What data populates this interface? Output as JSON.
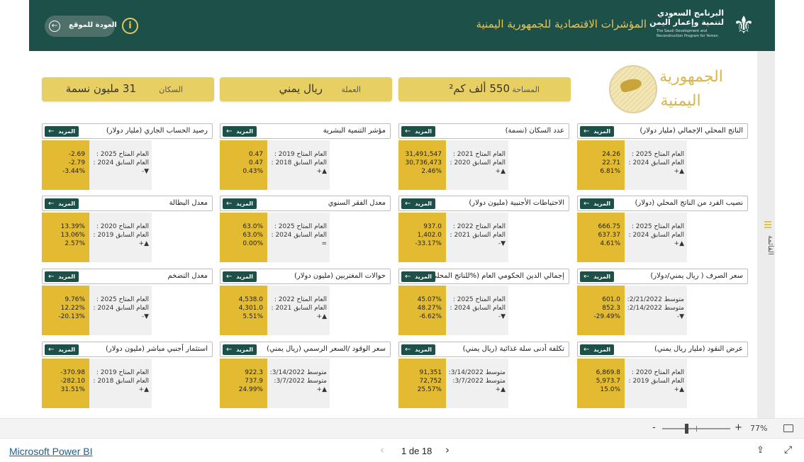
{
  "header": {
    "logo_ar_line1": "البرنامج السعودي",
    "logo_ar_line2": "لتنمية وإعمار اليمن",
    "logo_en": "The Saudi Development and Reconstruction Program for Yemen",
    "title": "المؤشرات الاقتصادية للجمهورية اليمنية",
    "info_glyph": "i",
    "back_label": "العودة للموقع",
    "back_glyph": "←"
  },
  "country": {
    "line1": "الجمهورية",
    "line2": "اليمنية"
  },
  "stats": [
    {
      "label": "المساحة",
      "value": "550 ألف كم²"
    },
    {
      "label": "العملة",
      "value": "ريال يمني"
    },
    {
      "label": "السكان",
      "value": "31 مليون نسمة"
    }
  ],
  "more_label": "المزيد",
  "more_glyph": "←",
  "cards": [
    {
      "title": "الناتج المحلي الإجمالي (مليار دولار)",
      "l1": "العام المتاح 2025 :",
      "l2": "العام السابق 2024 :",
      "trend": "▲+",
      "v1": "24.26",
      "v2": "22.71",
      "v3": "6.81%"
    },
    {
      "title": "عدد السكان (نسمة)",
      "l1": "العام المتاح 2021 :",
      "l2": "العام السابق 2020 :",
      "trend": "▲+",
      "v1": "31,491,547",
      "v2": "30,736,473",
      "v3": "2.46%"
    },
    {
      "title": "مؤشر التنمية البشرية",
      "l1": "العام المتاح 2019 :",
      "l2": "العام السابق 2018 :",
      "trend": "▲+",
      "v1": "0.47",
      "v2": "0.47",
      "v3": "0.43%"
    },
    {
      "title": "رصيد الحساب الجاري (مليار دولار)",
      "l1": "العام المتاح 2025 :",
      "l2": "العام السابق 2024 :",
      "trend": "▼-",
      "v1": "-2.69",
      "v2": "-2.79",
      "v3": "-3.44%"
    },
    {
      "title": "نصيب الفرد من الناتج المحلي (دولار)",
      "l1": "العام المتاح 2025 :",
      "l2": "العام السابق 2024 :",
      "trend": "▲+",
      "v1": "666.75",
      "v2": "637.37",
      "v3": "4.61%"
    },
    {
      "title": "الاحتياطات الأجنبية (مليون دولار)",
      "l1": "العام المتاح 2022 :",
      "l2": "العام السابق 2021 :",
      "trend": "▼-",
      "v1": "937.0",
      "v2": "1,402.0",
      "v3": "-33.17%"
    },
    {
      "title": "معدل الفقر السنوي",
      "l1": "العام المتاح 2025 :",
      "l2": "العام السابق 2024 :",
      "trend": "=",
      "v1": "63.0%",
      "v2": "63.0%",
      "v3": "0.00%"
    },
    {
      "title": "معدل البطالة",
      "l1": "العام المتاح 2020 :",
      "l2": "العام السابق 2019 :",
      "trend": "▲+",
      "v1": "13.39%",
      "v2": "13.06%",
      "v3": "2.57%"
    },
    {
      "title": "سعر الصرف ( ريال يمني/دولار)",
      "l1": "متوسط 2/21/2022:",
      "l2": "متوسط 2/14/2022:",
      "trend": "▼-",
      "v1": "601.0",
      "v2": "852.3",
      "v3": "-29.49%"
    },
    {
      "title": "إجمالي الدين الحكومي العام (%للناتج المحلي)",
      "l1": "العام المتاح 2025 :",
      "l2": "العام السابق 2024 :",
      "trend": "▼-",
      "v1": "45.07%",
      "v2": "48.27%",
      "v3": "-6.62%"
    },
    {
      "title": "حوالات المغتربين (مليون دولار)",
      "l1": "العام المتاح 2022 :",
      "l2": "العام السابق 2021 :",
      "trend": "▲+",
      "v1": "4,538.0",
      "v2": "4,301.0",
      "v3": "5.51%"
    },
    {
      "title": "معدل التضخم",
      "l1": "العام المتاح 2025 :",
      "l2": "العام السابق 2024 :",
      "trend": "▼-",
      "v1": "9.76%",
      "v2": "12.22%",
      "v3": "-20.13%"
    },
    {
      "title": "عرض النقود (مليار ريال يمني)",
      "l1": "العام المتاح 2020 :",
      "l2": "العام السابق 2019 :",
      "trend": "▲+",
      "v1": "6,869.8",
      "v2": "5,973.7",
      "v3": "15.0%"
    },
    {
      "title": "تكلفة أدنى سلة غذائية (ريال يمني)",
      "l1": "متوسط 3/14/2022:",
      "l2": "متوسط 3/7/2022:",
      "trend": "▲+",
      "v1": "91,351",
      "v2": "72,752",
      "v3": "25.57%"
    },
    {
      "title": "سعر الوقود /السعر الرسمي (ريال يمني)",
      "l1": "متوسط 3/14/2022:",
      "l2": "متوسط 3/7/2022:",
      "trend": "▲+",
      "v1": "922.3",
      "v2": "737.9",
      "v3": "24.99%"
    },
    {
      "title": "استثمار أجنبي مباشر (مليون دولار)",
      "l1": "العام المتاح 2019 :",
      "l2": "العام السابق 2018 :",
      "trend": "▲+",
      "v1": "-370.98",
      "v2": "-282.10",
      "v3": "31.51%"
    }
  ],
  "side": {
    "menu_label": "القائمة"
  },
  "footer": {
    "zoom_minus": "-",
    "zoom_plus": "+",
    "zoom_pct": "77%",
    "zoom_level": 0.77,
    "brand": "Microsoft Power BI",
    "prev_glyph": "‹",
    "page": "1 de 18",
    "next_glyph": "›",
    "share_glyph": "⇪",
    "expand_glyph": "⤢"
  }
}
